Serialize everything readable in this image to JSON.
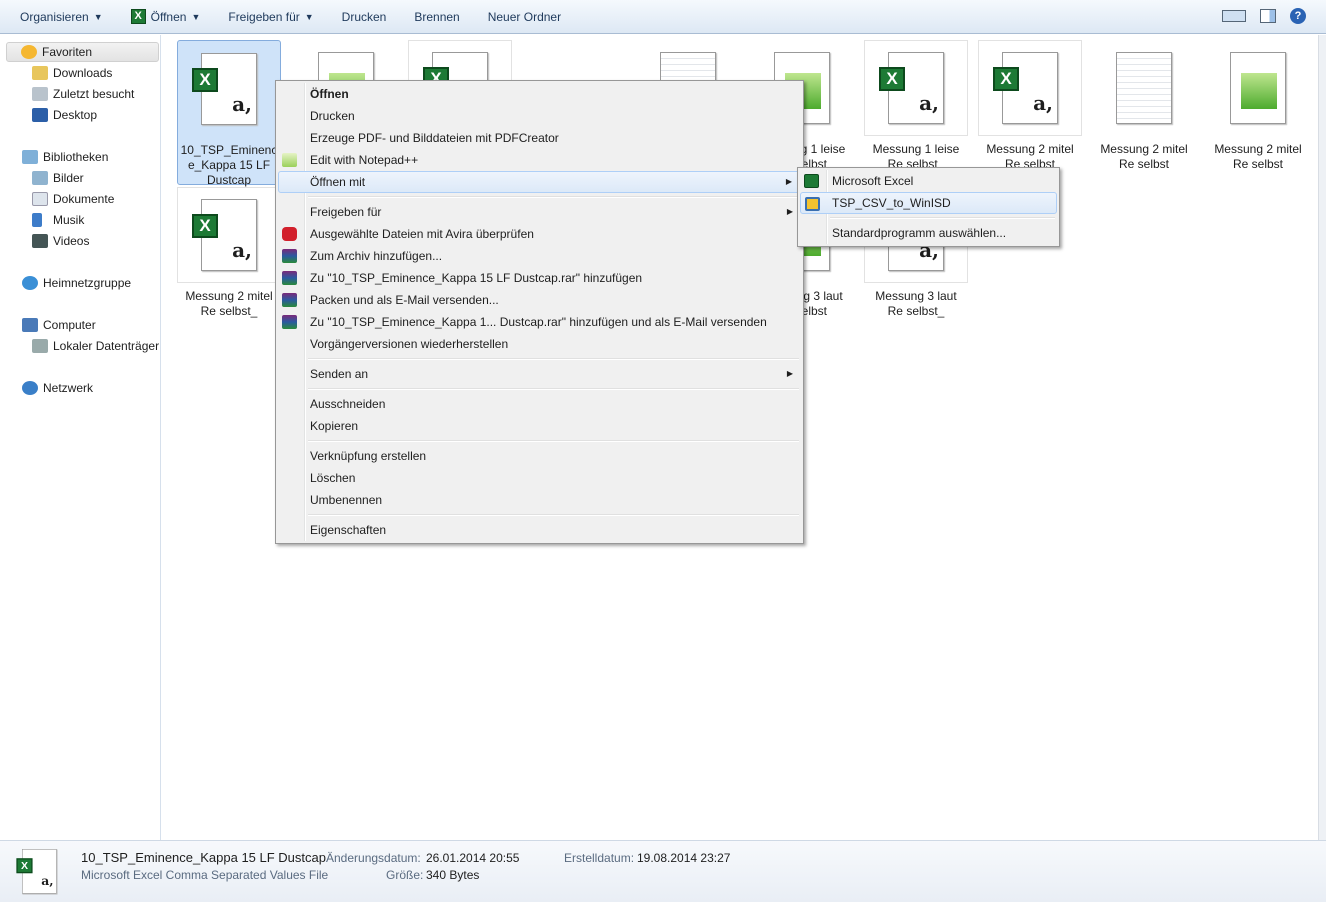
{
  "toolbar": {
    "organize": "Organisieren",
    "open": "Öffnen",
    "share": "Freigeben für",
    "print": "Drucken",
    "burn": "Brennen",
    "new_folder": "Neuer Ordner",
    "help": "?"
  },
  "nav": {
    "favorites": "Favoriten",
    "downloads": "Downloads",
    "recent": "Zuletzt besucht",
    "desktop": "Desktop",
    "libraries": "Bibliotheken",
    "pictures": "Bilder",
    "documents": "Dokumente",
    "music": "Musik",
    "videos": "Videos",
    "homegroup": "Heimnetzgruppe",
    "computer": "Computer",
    "local_disk": "Lokaler Datenträger",
    "network": "Netzwerk"
  },
  "files": [
    {
      "name": "10_TSP_Eminence_Kappa 15 LF Dustcap",
      "label1": "10_TSP_Eminenc",
      "label2": "e_Kappa 15 LF",
      "label3": "Dustcap"
    },
    {
      "label1": "Messung 1 leise",
      "label2": "Re selbst"
    },
    {
      "label1": "Messung 1 leise",
      "label2": "Re selbst_"
    },
    {
      "label1": "Messung 2 mitel",
      "label2": "Re selbst"
    },
    {
      "label1": "Messung 2 mitel",
      "label2": "Re selbst"
    },
    {
      "label1": "Messung 2 mitel",
      "label2": "Re selbst"
    },
    {
      "label1": "Messung 2 mitel",
      "label2": "Re selbst_"
    },
    {
      "label1": "Messung 3 laut",
      "label2": "Re selbst"
    },
    {
      "label1": "Messung 3 laut",
      "label2": "Re selbst_"
    }
  ],
  "context_menu": {
    "items": [
      "Öffnen",
      "Drucken",
      "Erzeuge PDF- und Bilddateien mit PDFCreator",
      "Edit with Notepad++",
      "Öffnen mit",
      "Freigeben für",
      "Ausgewählte Dateien mit Avira überprüfen",
      "Zum Archiv hinzufügen...",
      "Zu \"10_TSP_Eminence_Kappa 15 LF Dustcap.rar\" hinzufügen",
      "Packen und als E-Mail versenden...",
      "Zu \"10_TSP_Eminence_Kappa 1... Dustcap.rar\" hinzufügen und als E-Mail versenden",
      "Vorgängerversionen wiederherstellen",
      "Senden an",
      "Ausschneiden",
      "Kopieren",
      "Verknüpfung erstellen",
      "Löschen",
      "Umbenennen",
      "Eigenschaften"
    ]
  },
  "submenu": {
    "items": [
      "Microsoft Excel",
      "TSP_CSV_to_WinISD",
      "Standardprogramm auswählen..."
    ]
  },
  "status": {
    "filename": "10_TSP_Eminence_Kappa 15 LF Dustcap",
    "type": "Microsoft Excel Comma Separated Values File",
    "modified_label": "Änderungsdatum:",
    "modified": "26.01.2014 20:55",
    "size_label": "Größe:",
    "size": "340 Bytes",
    "created_label": "Erstelldatum:",
    "created": "19.08.2014 23:27"
  }
}
